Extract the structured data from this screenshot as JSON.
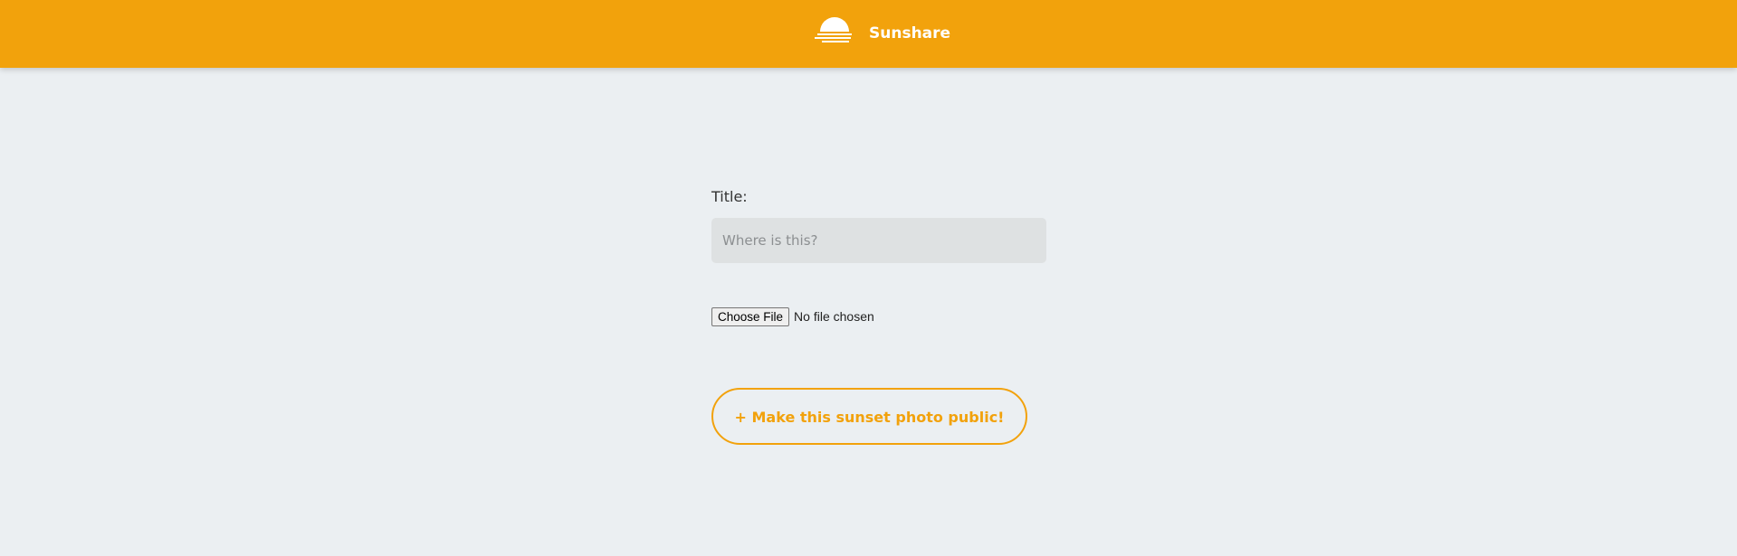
{
  "header": {
    "brand_name": "Sunshare",
    "logo_icon": "sunset-icon",
    "background_color": "#f2a20c"
  },
  "form": {
    "title_label": "Title:",
    "title_placeholder": "Where is this?",
    "title_value": "",
    "file_button_label": "Choose File",
    "file_status": "No file chosen",
    "submit_label": "+ Make this sunset photo public!"
  },
  "colors": {
    "accent": "#f2a20c",
    "page_background": "#ebeff2",
    "input_background": "#dee1e2"
  }
}
